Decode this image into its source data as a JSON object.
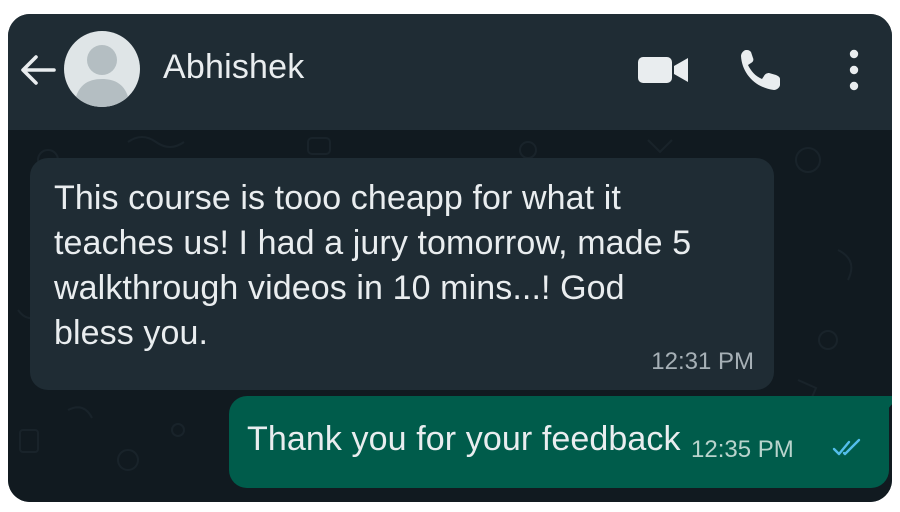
{
  "header": {
    "contact_name": "Abhishek",
    "icons": [
      "back-arrow-icon",
      "avatar-placeholder-icon",
      "video-call-icon",
      "phone-icon",
      "more-vert-icon"
    ]
  },
  "messages": [
    {
      "direction": "incoming",
      "lines": [
        "This course is tooo cheapp for what it",
        "teaches us! I had a jury tomorrow, made 5",
        "walkthrough videos in 10 mins...! God",
        "bless you."
      ],
      "time": "12:31 PM"
    },
    {
      "direction": "outgoing",
      "text": "Thank you for your feedback",
      "time": "12:35 PM",
      "status": "read-ticks-icon"
    }
  ],
  "colors": {
    "header_bg": "#1f2c34",
    "chat_bg": "#111a20",
    "incoming_bubble": "#1f2c34",
    "outgoing_bubble": "#005c4b",
    "read_ticks": "#53bdeb",
    "text": "#e9edef"
  }
}
